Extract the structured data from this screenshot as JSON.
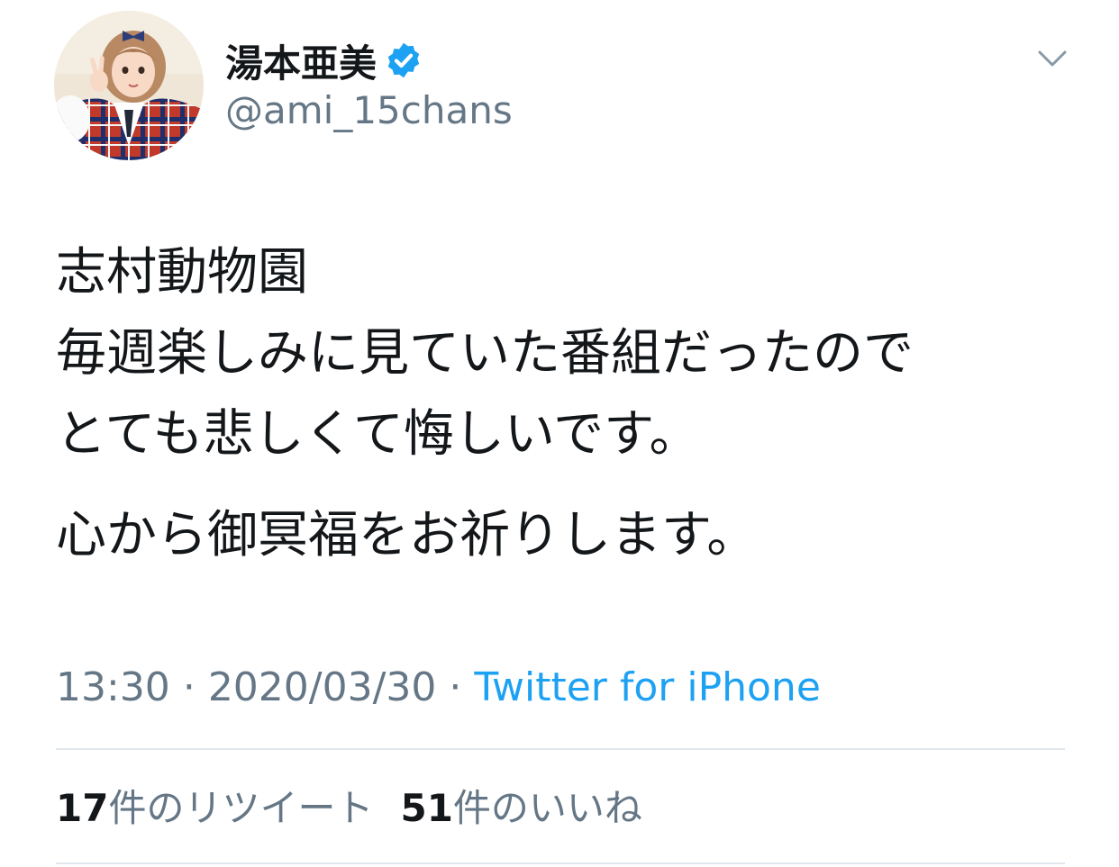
{
  "user": {
    "display_name": "湯本亜美",
    "handle": "@ami_15chans",
    "verified": true,
    "avatar_icon": "profile-photo"
  },
  "header": {
    "menu_icon": "chevron-down-icon"
  },
  "tweet": {
    "lines": [
      "志村動物園",
      "毎週楽しみに見ていた番組だったので",
      "とても悲しくて悔しいです。",
      "心から御冥福をお祈りします。"
    ],
    "time": "13:30",
    "date": "2020/03/30",
    "separator": "·",
    "source": "Twitter for iPhone"
  },
  "stats": {
    "retweets_count": "17",
    "retweets_label": "件のリツイート",
    "likes_count": "51",
    "likes_label": "件のいいね"
  },
  "colors": {
    "text": "#14171a",
    "secondary": "#657786",
    "link": "#1da1f2",
    "verified": "#1da1f2",
    "divider": "#e1e8ed"
  }
}
